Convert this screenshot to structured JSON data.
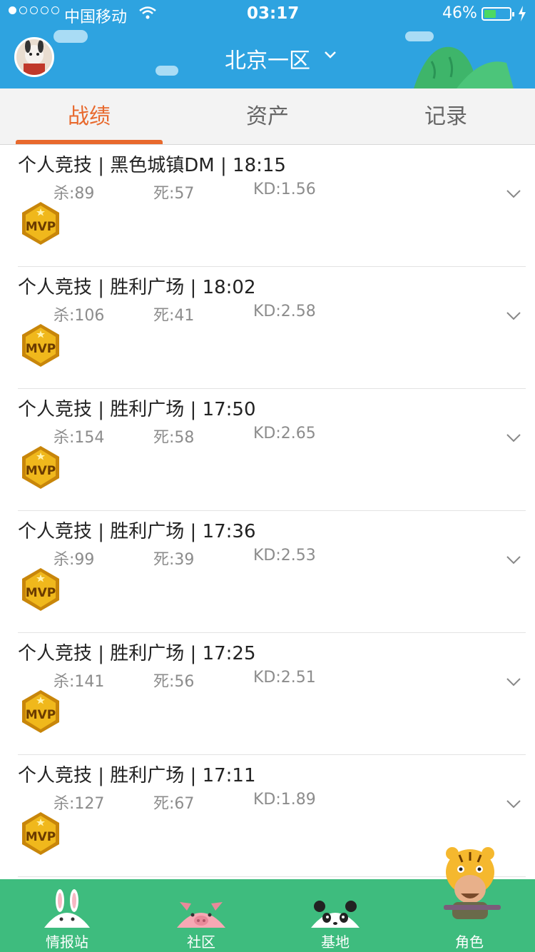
{
  "status_bar": {
    "carrier": "中国移动",
    "time": "03:17",
    "battery_percent": "46%",
    "battery_level": 0.46,
    "signal_bars": 1
  },
  "header": {
    "region": "北京一区",
    "avatar_icon": "user-avatar-icon"
  },
  "tabs": [
    {
      "label": "战绩",
      "active": true
    },
    {
      "label": "资产",
      "active": false
    },
    {
      "label": "记录",
      "active": false
    }
  ],
  "matches": [
    {
      "title": "个人竞技 | 黑色城镇DM | 18:15",
      "kills": "杀:89",
      "deaths": "死:57",
      "kd": "KD:1.56",
      "badge": "MVP"
    },
    {
      "title": "个人竞技 | 胜利广场 | 18:02",
      "kills": "杀:106",
      "deaths": "死:41",
      "kd": "KD:2.58",
      "badge": "MVP"
    },
    {
      "title": "个人竞技 | 胜利广场 | 17:50",
      "kills": "杀:154",
      "deaths": "死:58",
      "kd": "KD:2.65",
      "badge": "MVP"
    },
    {
      "title": "个人竞技 | 胜利广场 | 17:36",
      "kills": "杀:99",
      "deaths": "死:39",
      "kd": "KD:2.53",
      "badge": "MVP"
    },
    {
      "title": "个人竞技 | 胜利广场 | 17:25",
      "kills": "杀:141",
      "deaths": "死:56",
      "kd": "KD:2.51",
      "badge": "MVP"
    },
    {
      "title": "个人竞技 | 胜利广场 | 17:11",
      "kills": "杀:127",
      "deaths": "死:67",
      "kd": "KD:1.89",
      "badge": "MVP"
    }
  ],
  "bottom_nav": [
    {
      "label": "情报站",
      "icon": "rabbit-icon"
    },
    {
      "label": "社区",
      "icon": "pig-icon"
    },
    {
      "label": "基地",
      "icon": "panda-icon"
    },
    {
      "label": "角色",
      "icon": "tiger-soldier-icon"
    }
  ],
  "colors": {
    "header_blue": "#2ea3e0",
    "accent_orange": "#e8692d",
    "nav_green": "#3ebc7e",
    "mvp_gold": "#f0b81c"
  }
}
